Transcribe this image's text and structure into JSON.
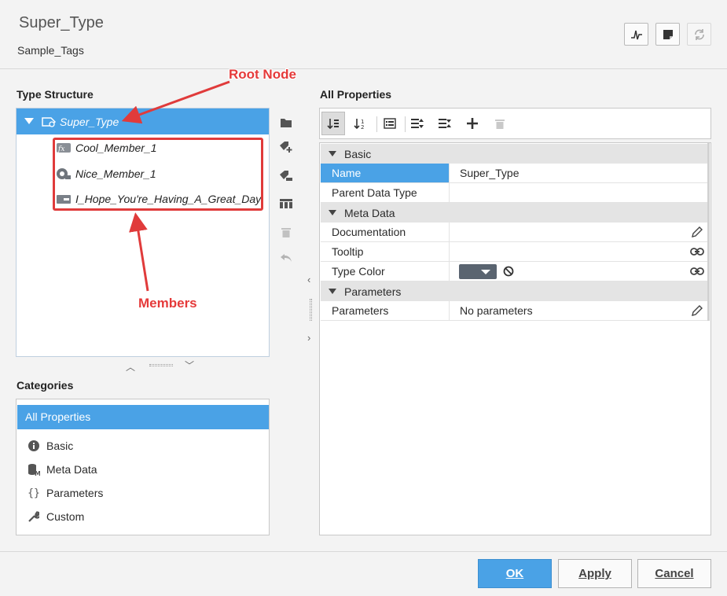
{
  "header": {
    "title": "Super_Type",
    "subtitle": "Sample_Tags"
  },
  "header_buttons": [
    {
      "name": "chart-icon"
    },
    {
      "name": "note-icon"
    },
    {
      "name": "refresh-icon"
    }
  ],
  "type_structure": {
    "title": "Type Structure",
    "root": "Super_Type",
    "members": [
      {
        "label": "Cool_Member_1",
        "icon": "expression-tag-icon"
      },
      {
        "label": "Nice_Member_1",
        "icon": "opc-tag-icon"
      },
      {
        "label": "I_Hope_You're_Having_A_Great_Day",
        "icon": "memory-tag-icon"
      }
    ]
  },
  "annotations": {
    "root_node": "Root Node",
    "members": "Members"
  },
  "categories": {
    "title": "Categories",
    "selected": "All Properties",
    "items": [
      {
        "label": "Basic",
        "icon": "info-icon"
      },
      {
        "label": "Meta Data",
        "icon": "database-icon"
      },
      {
        "label": "Parameters",
        "icon": "braces-icon"
      },
      {
        "label": "Custom",
        "icon": "wrench-icon"
      }
    ]
  },
  "properties": {
    "title": "All Properties",
    "groups": {
      "basic": "Basic",
      "meta": "Meta Data",
      "params": "Parameters"
    },
    "rows": {
      "name_key": "Name",
      "name_val": "Super_Type",
      "parent_key": "Parent Data Type",
      "parent_val": "",
      "doc_key": "Documentation",
      "tooltip_key": "Tooltip",
      "color_key": "Type Color",
      "params_key": "Parameters",
      "params_val": "No parameters"
    }
  },
  "colors": {
    "accent": "#4aa2e6",
    "annotation": "#e03b3b",
    "swatch": "#5a6470"
  },
  "footer": {
    "ok": "OK",
    "apply": "Apply",
    "cancel": "Cancel"
  }
}
